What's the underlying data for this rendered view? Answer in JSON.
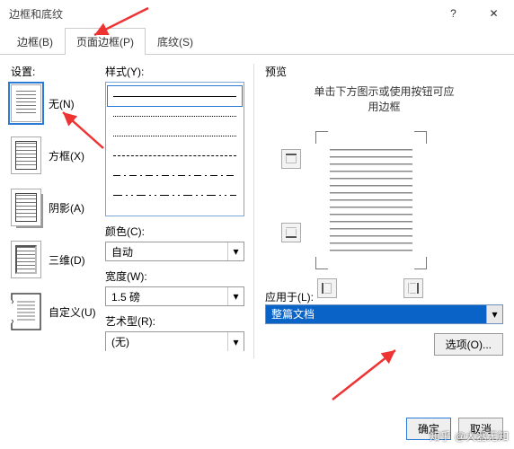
{
  "window": {
    "title": "边框和底纹"
  },
  "tabs": {
    "border": "边框(B)",
    "page_border": "页面边框(P)",
    "shading": "底纹(S)"
  },
  "settings": {
    "header": "设置:",
    "none": "无(N)",
    "box": "方框(X)",
    "shadow": "阴影(A)",
    "threed": "三维(D)",
    "custom": "自定义(U)"
  },
  "style": {
    "label": "样式(Y):"
  },
  "color": {
    "label": "颜色(C):",
    "value": "自动"
  },
  "width": {
    "label": "宽度(W):",
    "value": "1.5 磅"
  },
  "art": {
    "label": "艺术型(R):",
    "value": "(无)"
  },
  "preview": {
    "header": "预览",
    "hint1": "单击下方图示或使用按钮可应",
    "hint2": "用边框"
  },
  "apply": {
    "label": "应用于(L):",
    "value": "整篇文档"
  },
  "buttons": {
    "options": "选项(O)...",
    "ok": "确定",
    "cancel": "取消"
  },
  "watermark": "@大器无知"
}
